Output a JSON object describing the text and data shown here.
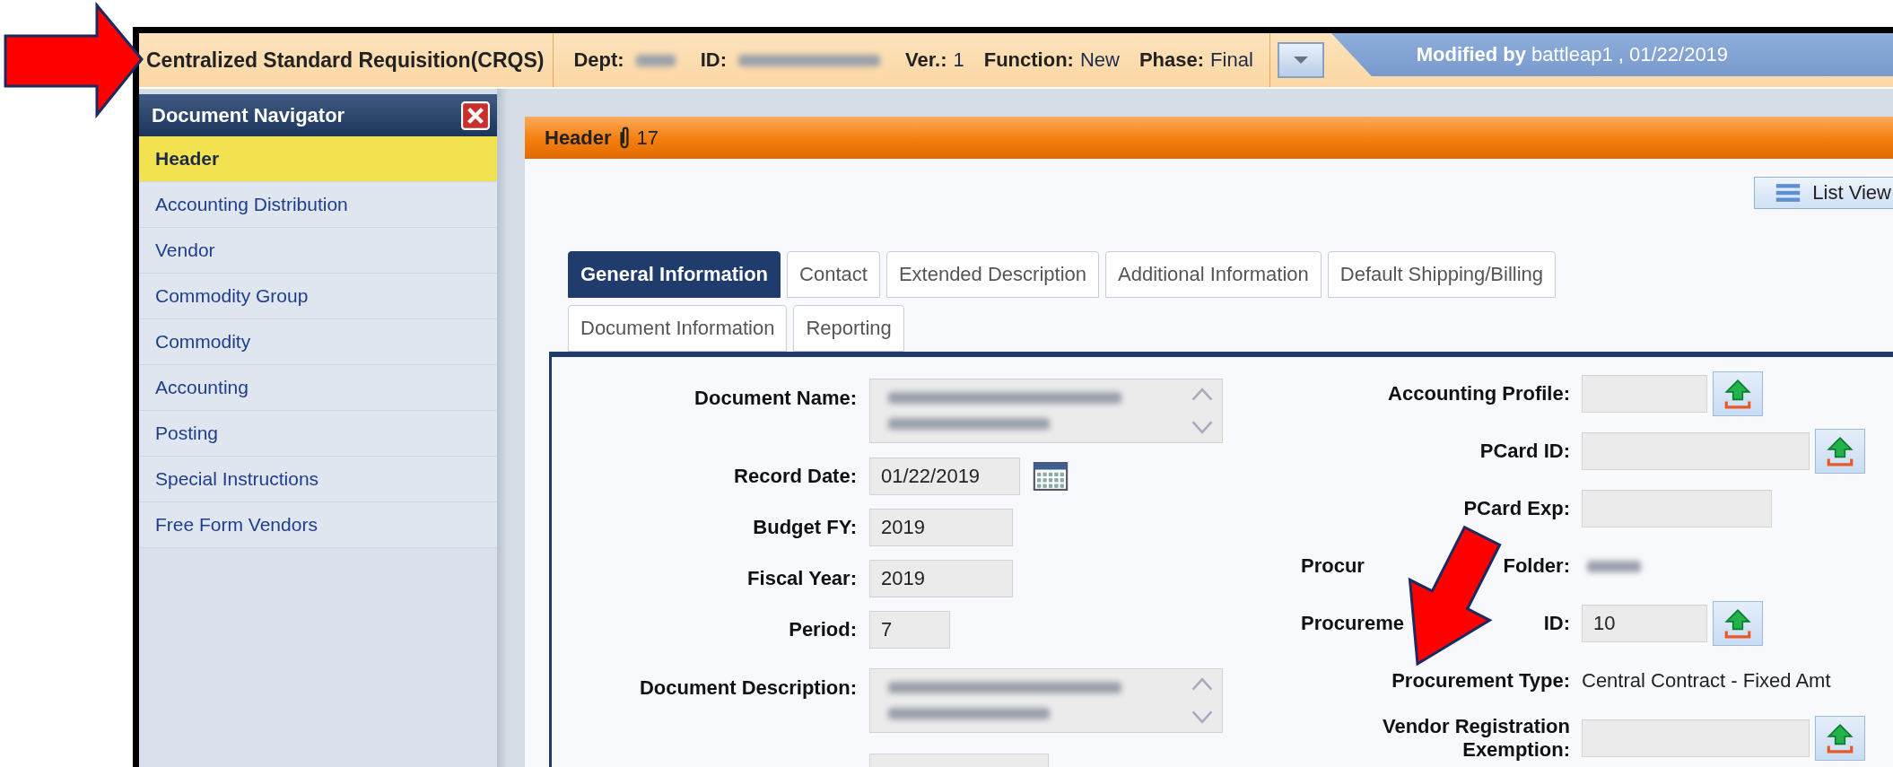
{
  "document_bar": {
    "title": "Centralized Standard Requisition(CRQS)",
    "fields": [
      {
        "label": "Dept:",
        "redacted": true
      },
      {
        "label": "ID:",
        "redacted": true
      },
      {
        "label": "Ver.:",
        "value": "1",
        "redacted": false
      },
      {
        "label": "Function:",
        "value": "New",
        "redacted": false
      },
      {
        "label": "Phase:",
        "value": "Final",
        "redacted": false
      }
    ],
    "modified": "**Modified by** battleap1 , 01/22/2019"
  },
  "navigator": {
    "title": "Document Navigator",
    "items": [
      {
        "label": "Header",
        "selected": true
      },
      {
        "label": "Accounting Distribution",
        "selected": false
      },
      {
        "label": "Vendor",
        "selected": false
      },
      {
        "label": "Commodity  Group",
        "selected": false
      },
      {
        "label": "Commodity",
        "selected": false
      },
      {
        "label": "Accounting",
        "selected": false
      },
      {
        "label": "Posting",
        "selected": false
      },
      {
        "label": "Special Instructions",
        "selected": false
      },
      {
        "label": "Free Form Vendors",
        "selected": false
      }
    ]
  },
  "section": {
    "title": "Header",
    "attachment_count": "17",
    "list_view_button": "List View"
  },
  "tab_rows": [
    {
      "tabs": [
        {
          "label": "General Information",
          "selected": true
        },
        {
          "label": "Contact",
          "selected": false
        },
        {
          "label": "Extended Description",
          "selected": false
        },
        {
          "label": "Additional Information",
          "selected": false
        },
        {
          "label": "Default Shipping/Billing",
          "selected": false
        }
      ]
    },
    {
      "tabs": [
        {
          "label": "Document Information",
          "selected": false
        },
        {
          "label": "Reporting",
          "selected": false
        }
      ]
    }
  ],
  "left_fields": [
    {
      "kind": "textarea",
      "label": "Document Name:",
      "redacted": true
    },
    {
      "kind": "date",
      "label": "Record Date:",
      "value": "01/22/2019",
      "redacted": false
    },
    {
      "kind": "text",
      "label": "Budget FY:",
      "value": "2019",
      "redacted": false
    },
    {
      "kind": "text",
      "label": "Fiscal Year:",
      "value": "2019",
      "redacted": false
    },
    {
      "kind": "short",
      "label": "Period:",
      "value": "7",
      "redacted": false
    },
    {
      "kind": "textarea",
      "label": "Document Description:",
      "redacted": true
    },
    {
      "kind": "text",
      "redacted": false
    }
  ],
  "right_fields": [
    {
      "kind": "lookup",
      "label_parts": [
        "Accounting Profile:"
      ],
      "redacted": false
    },
    {
      "kind": "wide_lookup",
      "label_parts": [
        "PCard ID:"
      ],
      "redacted": false
    },
    {
      "kind": "text",
      "label_parts": [
        "PCard Exp:"
      ],
      "redacted": false
    },
    {
      "kind": "static",
      "label_parts": [
        "Procur",
        "Folder:"
      ],
      "redacted": true
    },
    {
      "kind": "lookup",
      "label_parts": [
        "Procureme",
        "ID:"
      ],
      "value": "10",
      "redacted": false
    },
    {
      "kind": "static",
      "label_parts": [
        "Procurement Type:"
      ],
      "value": "Central Contract - Fixed Amt",
      "redacted": false
    },
    {
      "kind": "wide_lookup",
      "label_parts": [
        "Vendor Registration Exemption:"
      ],
      "redacted": false
    }
  ]
}
